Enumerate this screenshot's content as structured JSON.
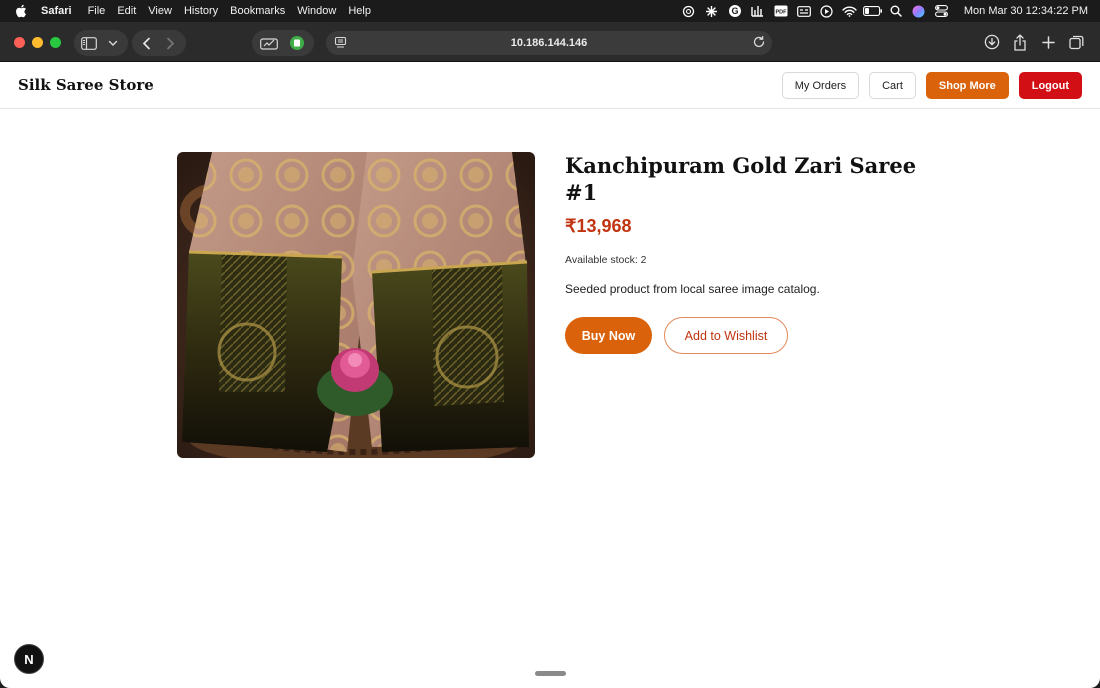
{
  "menubar": {
    "app_name": "Safari",
    "menus": [
      "File",
      "Edit",
      "View",
      "History",
      "Bookmarks",
      "Window",
      "Help"
    ],
    "status_icons": [
      "openai-icon",
      "pinwheel-icon",
      "grammarly-icon",
      "audio-meter-icon",
      "pdf-icon",
      "caption-icon",
      "play-icon",
      "wifi-icon",
      "battery-icon",
      "search-icon",
      "siri-icon",
      "control-center-icon"
    ],
    "clock": "Mon Mar 30  12:34:22 PM"
  },
  "browser": {
    "url": "10.186.144.146"
  },
  "site": {
    "brand": "Silk Saree Store",
    "nav": {
      "my_orders": "My Orders",
      "cart": "Cart",
      "shop_more": "Shop More",
      "logout": "Logout"
    }
  },
  "product": {
    "title": "Kanchipuram Gold Zari Saree #1",
    "price": "₹13,968",
    "stock": "Available stock: 2",
    "description": "Seeded product from local saree image catalog.",
    "buy_label": "Buy Now",
    "wishlist_label": "Add to Wishlist"
  },
  "dev_badge": "N",
  "colors": {
    "accent_orange": "#d9620b",
    "logout_red": "#d20f14",
    "price_red": "#c0340f"
  }
}
